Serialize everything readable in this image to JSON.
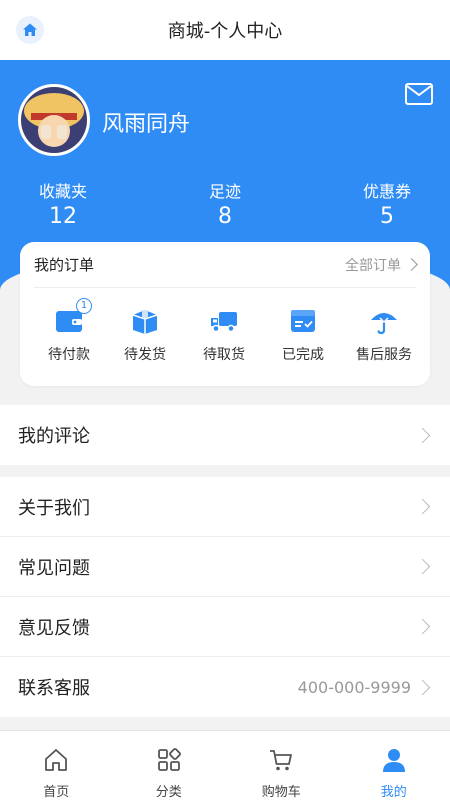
{
  "header": {
    "title": "商城-个人中心",
    "home_icon": "home-icon"
  },
  "profile": {
    "username": "风雨同舟",
    "mail_icon": "mail-icon"
  },
  "stats": [
    {
      "label": "收藏夹",
      "value": "12"
    },
    {
      "label": "足迹",
      "value": "8"
    },
    {
      "label": "优惠券",
      "value": "5"
    }
  ],
  "orders": {
    "title": "我的订单",
    "all_label": "全部订单",
    "items": [
      {
        "label": "待付款",
        "icon": "wallet-icon",
        "badge": "1"
      },
      {
        "label": "待发货",
        "icon": "package-icon"
      },
      {
        "label": "待取货",
        "icon": "truck-icon"
      },
      {
        "label": "已完成",
        "icon": "completed-box-icon"
      },
      {
        "label": "售后服务",
        "icon": "umbrella-icon"
      }
    ]
  },
  "menu_group_1": [
    {
      "label": "我的评论"
    }
  ],
  "menu_group_2": [
    {
      "label": "关于我们"
    },
    {
      "label": "常见问题"
    },
    {
      "label": "意见反馈"
    },
    {
      "label": "联系客服",
      "value": "400-000-9999"
    }
  ],
  "tabbar": [
    {
      "label": "首页",
      "icon": "home-outline-icon"
    },
    {
      "label": "分类",
      "icon": "category-icon"
    },
    {
      "label": "购物车",
      "icon": "cart-icon"
    },
    {
      "label": "我的",
      "icon": "user-icon",
      "active": true
    }
  ],
  "colors": {
    "accent": "#2f8cf5",
    "background": "#f2f2f2"
  }
}
